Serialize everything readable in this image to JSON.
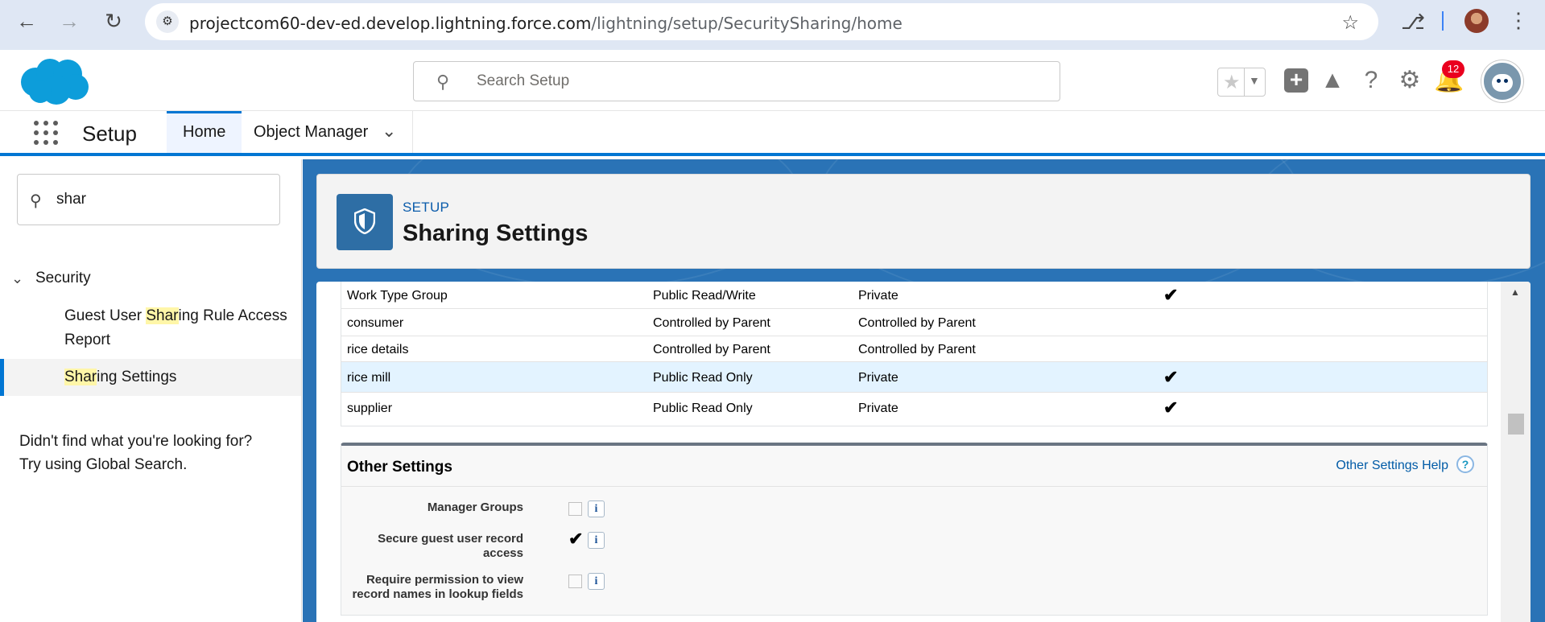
{
  "browser": {
    "url_domain": "projectcom60-dev-ed.develop.lightning.force.com",
    "url_path": "/lightning/setup/SecuritySharing/home"
  },
  "header": {
    "search_placeholder": "Search Setup",
    "notification_count": "12"
  },
  "tabbar": {
    "app_name": "Setup",
    "tabs": [
      {
        "label": "Home"
      },
      {
        "label": "Object Manager"
      }
    ]
  },
  "sidebar": {
    "quickfind_value": "shar",
    "section": "Security",
    "items": [
      {
        "pre": "Guest User ",
        "match": "Shar",
        "post": "ing Rule Access",
        "line2": "Report"
      },
      {
        "pre": "",
        "match": "Shar",
        "post": "ing Settings",
        "line2": ""
      }
    ],
    "hint_line1": "Didn't find what you're looking for?",
    "hint_line2": "Try using Global Search."
  },
  "page_header": {
    "eyebrow": "SETUP",
    "title": "Sharing Settings"
  },
  "sharing_table": {
    "rows": [
      {
        "object": "Work Type Group",
        "default_internal": "Public Read/Write",
        "default_external": "Private",
        "grant_access": "✔"
      },
      {
        "object": "consumer",
        "default_internal": "Controlled by Parent",
        "default_external": "Controlled by Parent",
        "grant_access": ""
      },
      {
        "object": "rice details",
        "default_internal": "Controlled by Parent",
        "default_external": "Controlled by Parent",
        "grant_access": ""
      },
      {
        "object": "rice mill",
        "default_internal": "Public Read Only",
        "default_external": "Private",
        "grant_access": "✔"
      },
      {
        "object": "supplier",
        "default_internal": "Public Read Only",
        "default_external": "Private",
        "grant_access": "✔"
      }
    ]
  },
  "other_settings": {
    "title": "Other Settings",
    "help_link": "Other Settings Help",
    "settings": [
      {
        "label_line1": "Manager Groups",
        "label_line2": "",
        "checked": false
      },
      {
        "label_line1": "Secure guest user record",
        "label_line2": "access",
        "checked": true
      },
      {
        "label_line1": "Require permission to view",
        "label_line2": "record names in lookup fields",
        "checked": false
      }
    ]
  },
  "icons": {
    "info": "i",
    "help": "?",
    "check": "✔"
  },
  "colors": {
    "brand_blue": "#0176d3",
    "content_bg": "#2a73b6",
    "highlight_row": "#e3f3ff",
    "search_match": "#fff6a8",
    "badge_red": "#ea001e"
  }
}
